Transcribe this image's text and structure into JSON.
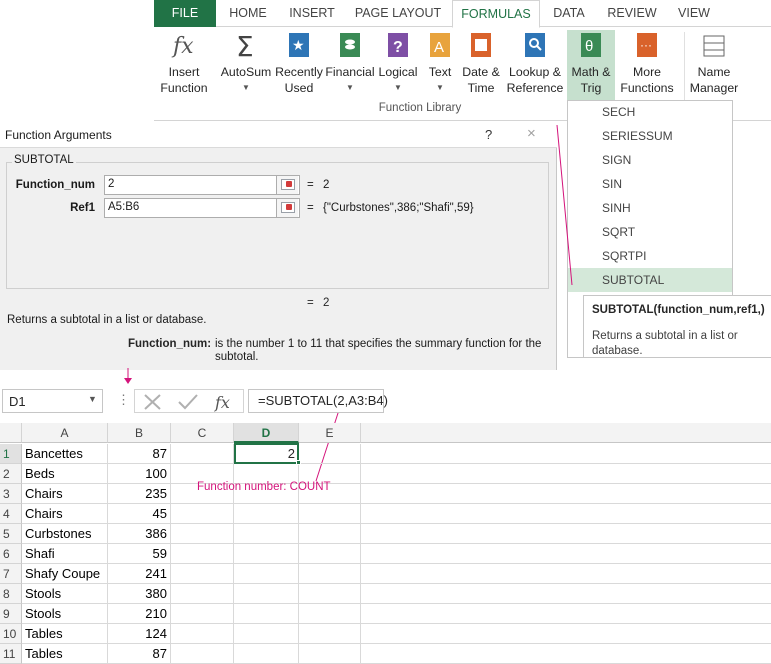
{
  "ribbon": {
    "tabs": [
      "FILE",
      "HOME",
      "INSERT",
      "PAGE LAYOUT",
      "FORMULAS",
      "DATA",
      "REVIEW",
      "VIEW"
    ],
    "buttons": {
      "insert_function": "Insert\nFunction",
      "autosum": "AutoSum",
      "recently_used": "Recently\nUsed",
      "financial": "Financial",
      "logical": "Logical",
      "text": "Text",
      "date_time": "Date &\nTime",
      "lookup_reference": "Lookup &\nReference",
      "math_trig": "Math &\nTrig",
      "more_functions": "More\nFunctions",
      "name_manager": "Name\nManager"
    },
    "group_label": "Function Library",
    "colors": {
      "file_tab": "#217346",
      "accent": "#217346"
    }
  },
  "dialog": {
    "title": "Function Arguments",
    "help": "?",
    "close": "×",
    "function_name": "SUBTOTAL",
    "args": [
      {
        "label": "Function_num",
        "value": "2",
        "eq": "=",
        "result": "2"
      },
      {
        "label": "Ref1",
        "value": "A5:B6",
        "eq": "=",
        "result": "{\"Curbstones\",386;\"Shafi\",59}"
      }
    ],
    "result_eq": "=",
    "result": "2",
    "description": "Returns a subtotal in a list or database.",
    "arg_desc_label": "Function_num:",
    "arg_desc_text": "is the number 1 to 11 that specifies the summary function for the subtotal."
  },
  "dropdown": {
    "items": [
      "SECH",
      "SERIESSUM",
      "SIGN",
      "SIN",
      "SINH",
      "SQRT",
      "SQRTPI",
      "SUBTOTAL"
    ],
    "selected": "SUBTOTAL"
  },
  "tooltip": {
    "title": "SUBTOTAL(function_num,ref1,)",
    "text": "Returns a subtotal in a list or database."
  },
  "formula_bar": {
    "name_box": "D1",
    "formula": "=SUBTOTAL(2,A3:B4)",
    "formula_prefix": "=SUBTOTAL(",
    "formula_arg": "2",
    "formula_suffix": ",A3:B4)"
  },
  "grid": {
    "columns": [
      "A",
      "B",
      "C",
      "D",
      "E"
    ],
    "rows": [
      {
        "n": "1",
        "a": "Bancettes",
        "b": "87"
      },
      {
        "n": "2",
        "a": "Beds",
        "b": "100"
      },
      {
        "n": "3",
        "a": "Chairs",
        "b": "235"
      },
      {
        "n": "4",
        "a": "Chairs",
        "b": "45"
      },
      {
        "n": "5",
        "a": "Curbstones",
        "b": "386"
      },
      {
        "n": "6",
        "a": "Shafi",
        "b": "59"
      },
      {
        "n": "7",
        "a": "Shafy Coupe",
        "b": "241"
      },
      {
        "n": "8",
        "a": "Stools",
        "b": "380"
      },
      {
        "n": "9",
        "a": "Stools",
        "b": "210"
      },
      {
        "n": "10",
        "a": "Tables",
        "b": "124"
      },
      {
        "n": "11",
        "a": "Tables",
        "b": "87"
      }
    ],
    "d1_value": "2",
    "active_cell": "D1"
  },
  "annotation": "Function number: COUNT"
}
